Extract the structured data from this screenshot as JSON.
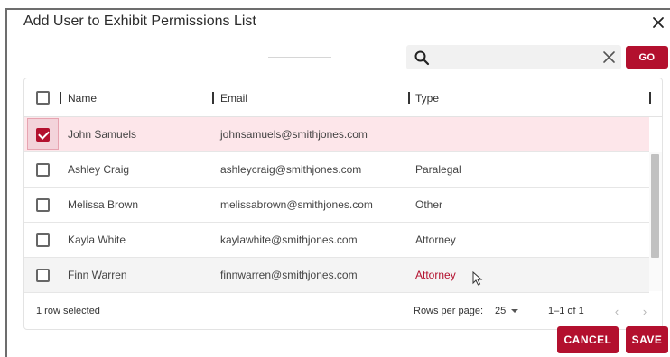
{
  "dialog": {
    "title": "Add User to Exhibit Permissions List",
    "close_icon": "close-icon"
  },
  "search": {
    "value": "",
    "placeholder": "",
    "search_icon": "search-icon",
    "clear_icon": "clear-icon",
    "go_label": "GO"
  },
  "table": {
    "columns": [
      "Name",
      "Email",
      "Type"
    ],
    "rows": [
      {
        "name": "John Samuels",
        "email": "johnsamuels@smithjones.com",
        "type": "",
        "checked": true
      },
      {
        "name": "Ashley Craig",
        "email": "ashleycraig@smithjones.com",
        "type": "Paralegal",
        "checked": false
      },
      {
        "name": "Melissa Brown",
        "email": "melissabrown@smithjones.com",
        "type": "Other",
        "checked": false
      },
      {
        "name": "Kayla White",
        "email": "kaylawhite@smithjones.com",
        "type": "Attorney",
        "checked": false
      },
      {
        "name": "Finn Warren",
        "email": "finnwarren@smithjones.com",
        "type": "Attorney",
        "checked": false
      }
    ]
  },
  "footer": {
    "selection_text": "1 row selected",
    "rows_per_page_label": "Rows per page:",
    "rows_per_page_value": "25",
    "range_text": "1–1 of 1"
  },
  "actions": {
    "cancel_label": "CANCEL",
    "save_label": "SAVE"
  },
  "colors": {
    "accent": "#b3102e",
    "selected_row": "#fde6ea"
  }
}
